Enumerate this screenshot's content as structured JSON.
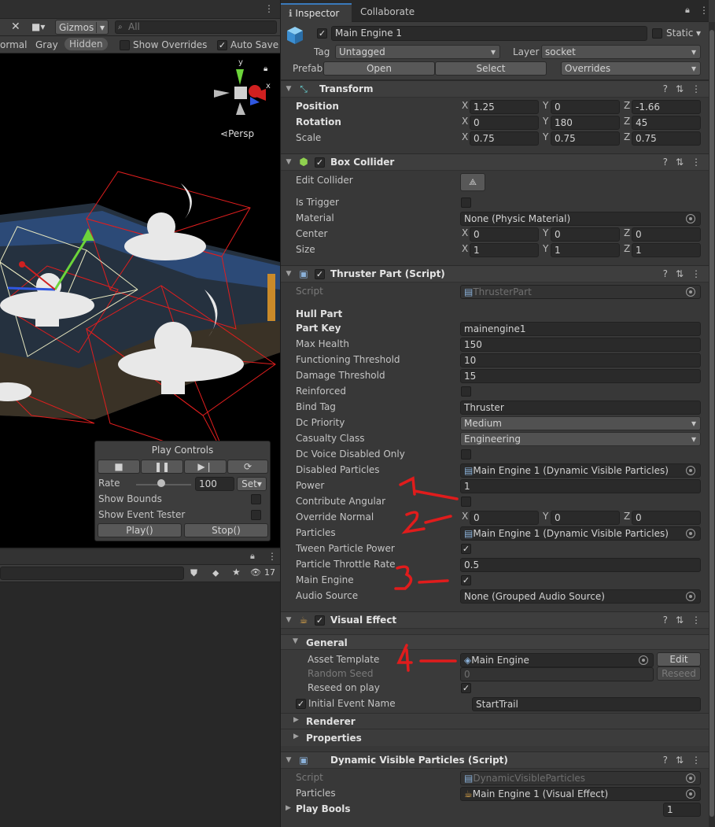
{
  "scene": {
    "shading_mode": "ormal",
    "gizmos_label": "Gizmos",
    "search_placeholder": "All",
    "filter_gray": "Gray",
    "filter_hidden": "Hidden",
    "show_overrides": "Show Overrides",
    "auto_save": "Auto Save",
    "persp": "Persp",
    "axis_x": "x",
    "axis_y": "y",
    "hierarchy_count": "17"
  },
  "play_controls": {
    "title": "Play Controls",
    "rate_label": "Rate",
    "rate_value": "100",
    "set_label": "Set",
    "show_bounds": "Show Bounds",
    "show_event_tester": "Show Event Tester",
    "play_button": "Play()",
    "stop_button": "Stop()"
  },
  "tabs": {
    "inspector": "Inspector",
    "collaborate": "Collaborate"
  },
  "object": {
    "name": "Main Engine 1",
    "static_label": "Static",
    "tag_label": "Tag",
    "tag_value": "Untagged",
    "layer_label": "Layer",
    "layer_value": "socket",
    "prefab_label": "Prefab",
    "open_button": "Open",
    "select_button": "Select",
    "overrides_label": "Overrides"
  },
  "transform": {
    "title": "Transform",
    "position_label": "Position",
    "rotation_label": "Rotation",
    "scale_label": "Scale",
    "position": [
      "1.25",
      "0",
      "-1.66"
    ],
    "rotation": [
      "0",
      "180",
      "45"
    ],
    "scale": [
      "0.75",
      "0.75",
      "0.75"
    ]
  },
  "axes": [
    "X",
    "Y",
    "Z"
  ],
  "box_collider": {
    "title": "Box Collider",
    "edit_collider": "Edit Collider",
    "is_trigger": "Is Trigger",
    "material_label": "Material",
    "material_value": "None (Physic Material)",
    "center_label": "Center",
    "center": [
      "0",
      "0",
      "0"
    ],
    "size_label": "Size",
    "size": [
      "1",
      "1",
      "1"
    ]
  },
  "thruster": {
    "title": "Thruster Part (Script)",
    "script_label": "Script",
    "script_value": "ThrusterPart",
    "hull_part": "Hull Part",
    "part_key_label": "Part Key",
    "part_key_value": "mainengine1",
    "max_health_label": "Max Health",
    "max_health_value": "150",
    "functioning_label": "Functioning Threshold",
    "functioning_value": "10",
    "damage_label": "Damage Threshold",
    "damage_value": "15",
    "reinforced_label": "Reinforced",
    "bind_tag_label": "Bind Tag",
    "bind_tag_value": "Thruster",
    "dc_priority_label": "Dc Priority",
    "dc_priority_value": "Medium",
    "casualty_label": "Casualty Class",
    "casualty_value": "Engineering",
    "dc_voice_label": "Dc Voice Disabled Only",
    "disabled_particles_label": "Disabled Particles",
    "disabled_particles_value": "Main Engine 1 (Dynamic Visible Particles)",
    "power_label": "Power",
    "power_value": "1",
    "contribute_label": "Contribute Angular",
    "override_normal_label": "Override Normal",
    "override_normal": [
      "0",
      "0",
      "0"
    ],
    "particles_label": "Particles",
    "particles_value": "Main Engine 1 (Dynamic Visible Particles)",
    "tween_label": "Tween Particle Power",
    "throttle_label": "Particle Throttle Rate",
    "throttle_value": "0.5",
    "main_engine_label": "Main Engine",
    "audio_label": "Audio Source",
    "audio_value": "None (Grouped Audio Source)"
  },
  "visual_effect": {
    "title": "Visual Effect",
    "general": "General",
    "asset_template_label": "Asset Template",
    "asset_template_value": "Main Engine",
    "edit_button": "Edit",
    "random_seed_label": "Random Seed",
    "random_seed_value": "0",
    "reseed_button": "Reseed",
    "reseed_on_play_label": "Reseed on play",
    "initial_event_label": "Initial Event Name",
    "initial_event_value": "StartTrail",
    "renderer": "Renderer",
    "properties": "Properties"
  },
  "dvp": {
    "title": "Dynamic Visible Particles (Script)",
    "script_label": "Script",
    "script_value": "DynamicVisibleParticles",
    "particles_label": "Particles",
    "particles_value": "Main Engine 1 (Visual Effect)",
    "play_bools_label": "Play Bools",
    "play_bools_value": "1"
  },
  "annotations": [
    "1",
    "2",
    "3",
    "4"
  ]
}
